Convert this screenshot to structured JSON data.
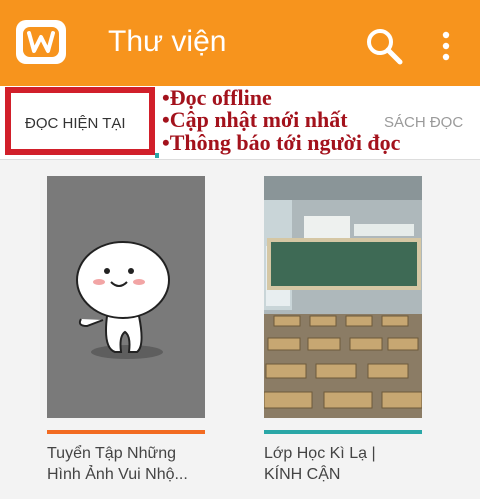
{
  "appbar": {
    "title": "Thư viện",
    "logo_icon": "w-logo-icon",
    "search_icon": "search-icon",
    "more_icon": "more-vert-icon",
    "color": "#f7941d"
  },
  "tabs": [
    {
      "label": "ĐỌC HIỆN TẠI",
      "selected": true
    },
    {
      "label": "SÁCH ĐỌC",
      "selected": false
    }
  ],
  "annotations": [
    "•Đọc offline",
    "•Cập nhật mới nhất",
    "•Thông báo tới người đọc"
  ],
  "books": [
    {
      "title_line1": "Tuyển Tập Những",
      "title_line2": "Hình Ảnh Vui Nhộ...",
      "accent": "#f26b21"
    },
    {
      "title_line1": "Lớp Học Kì Lạ |",
      "title_line2": "KÍNH CẬN",
      "accent": "#2aa7a7"
    }
  ]
}
